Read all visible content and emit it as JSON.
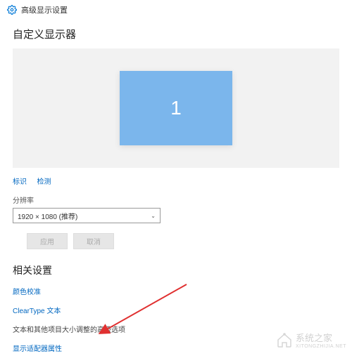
{
  "header": {
    "title": "高级显示设置"
  },
  "sections": {
    "custom_display": "自定义显示器",
    "related_settings": "相关设置"
  },
  "monitor": {
    "number": "1"
  },
  "links": {
    "identify": "标识",
    "detect": "检测"
  },
  "resolution": {
    "label": "分辨率",
    "value": "1920 × 1080 (推荐)"
  },
  "buttons": {
    "apply": "应用",
    "cancel": "取消"
  },
  "related": {
    "color_calibration": "颜色校准",
    "cleartype": "ClearType 文本",
    "text_sizing": "文本和其他项目大小调整的高级选项",
    "adapter_properties": "显示适配器属性"
  },
  "watermark": {
    "text": "系统之家",
    "url": "XITONGZHIJIA.NET"
  }
}
